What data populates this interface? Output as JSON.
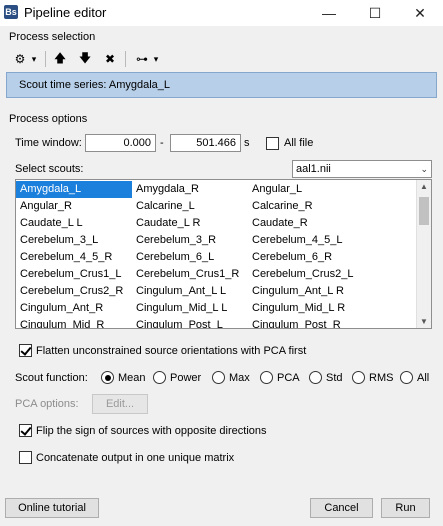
{
  "window": {
    "app_icon": "Bs",
    "title": "Pipeline editor",
    "minimize_icon": "—",
    "maximize_icon": "☐",
    "close_icon": "✕"
  },
  "process_selection": {
    "section_label": "Process selection",
    "toolbar": {
      "gear_icon": "⚙",
      "gear_menu_arrow": "▾",
      "move_up_icon": "🡅",
      "move_down_icon": "🡇",
      "delete_icon": "✖",
      "tree_icon": "⊶",
      "tree_menu_arrow": "▾"
    },
    "selected_process": "Scout time series: Amygdala_L"
  },
  "process_options": {
    "section_label": "Process options",
    "time_window": {
      "label": "Time window:",
      "start": "0.000",
      "separator": "-",
      "end": "501.466",
      "unit": "s",
      "all_file_label": "All file",
      "all_file_checked": false
    },
    "select_scouts": {
      "label": "Select scouts:",
      "atlas": "aal1.nii",
      "atlas_arrow": "⌄",
      "scroll_up": "▲",
      "scroll_down": "▼",
      "rows": [
        [
          "Amygdala_L",
          "Amygdala_R",
          "Angular_L"
        ],
        [
          "Angular_R",
          "Calcarine_L",
          "Calcarine_R"
        ],
        [
          "Caudate_L L",
          "Caudate_L R",
          "Caudate_R"
        ],
        [
          "Cerebelum_3_L",
          "Cerebelum_3_R",
          "Cerebelum_4_5_L"
        ],
        [
          "Cerebelum_4_5_R",
          "Cerebelum_6_L",
          "Cerebelum_6_R"
        ],
        [
          "Cerebelum_Crus1_L",
          "Cerebelum_Crus1_R",
          "Cerebelum_Crus2_L"
        ],
        [
          "Cerebelum_Crus2_R",
          "Cingulum_Ant_L L",
          "Cingulum_Ant_L R"
        ],
        [
          "Cingulum_Ant_R",
          "Cingulum_Mid_L L",
          "Cingulum_Mid_L R"
        ],
        [
          "Cingulum_Mid_R",
          "Cingulum_Post_L",
          "Cingulum_Post_R"
        ]
      ],
      "selected": "Amygdala_L"
    },
    "flatten": {
      "label": "Flatten unconstrained source orientations with PCA first",
      "checked": true
    },
    "scout_function": {
      "label": "Scout function:",
      "options": [
        "Mean",
        "Power",
        "Max",
        "PCA",
        "Std",
        "RMS",
        "All"
      ],
      "selected": "Mean"
    },
    "pca_options": {
      "label": "PCA options:",
      "button": "Edit..."
    },
    "flip_sign": {
      "label": "Flip the sign of sources with opposite directions",
      "checked": true
    },
    "concatenate": {
      "label": "Concatenate output in one unique matrix",
      "checked": false
    }
  },
  "footer": {
    "tutorial_button": "Online tutorial",
    "cancel_button": "Cancel",
    "run_button": "Run"
  }
}
